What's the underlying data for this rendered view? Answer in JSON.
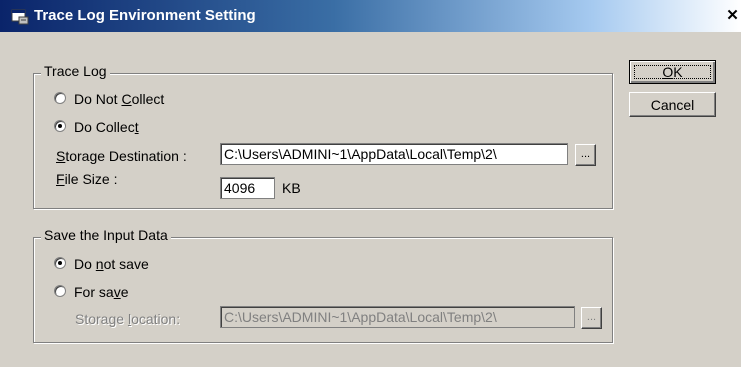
{
  "window": {
    "title": "Trace Log Environment Setting",
    "close_glyph": "✕",
    "icon": "app-window-icon"
  },
  "trace_log": {
    "legend": "Trace Log",
    "do_not_collect": {
      "pre": "Do Not ",
      "key": "C",
      "post": "ollect",
      "checked": false
    },
    "do_collect": {
      "pre": "Do Collec",
      "key": "t",
      "post": "",
      "checked": true
    },
    "storage_destination": {
      "pre": "",
      "key": "S",
      "post": "torage Destination :",
      "value": "C:\\Users\\ADMINI~1\\AppData\\Local\\Temp\\2\\"
    },
    "file_size": {
      "pre": "",
      "key": "F",
      "post": "ile Size :",
      "value": "4096",
      "unit": "KB"
    },
    "browse_label": "..."
  },
  "save_input": {
    "legend": "Save the Input Data",
    "do_not_save": {
      "pre": "Do ",
      "key": "n",
      "post": "ot save",
      "checked": true
    },
    "for_save": {
      "pre": "For sa",
      "key": "v",
      "post": "e",
      "checked": false
    },
    "storage_location": {
      "pre": "Storage ",
      "key": "l",
      "post": "ocation:",
      "value": "C:\\Users\\ADMINI~1\\AppData\\Local\\Temp\\2\\"
    },
    "browse_label": "..."
  },
  "buttons": {
    "ok": {
      "pre": "",
      "key": "O",
      "post": "K"
    },
    "cancel": "Cancel"
  },
  "colors": {
    "dialog_face": "#d4d0c8",
    "title_start": "#0a246a",
    "title_end": "#a6caf0"
  }
}
